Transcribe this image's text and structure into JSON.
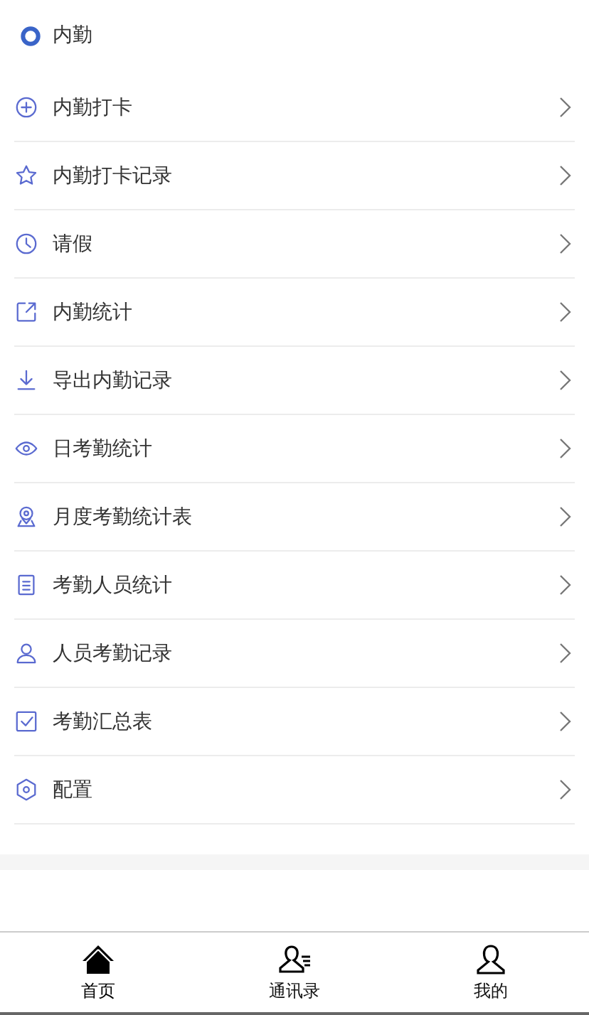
{
  "header": {
    "title": "内勤"
  },
  "menu": [
    {
      "kind": "plus",
      "label": "内勤打卡"
    },
    {
      "kind": "star",
      "label": "内勤打卡记录"
    },
    {
      "kind": "clock",
      "label": "请假"
    },
    {
      "kind": "share",
      "label": "内勤统计"
    },
    {
      "kind": "download",
      "label": "导出内勤记录"
    },
    {
      "kind": "eye",
      "label": "日考勤统计"
    },
    {
      "kind": "pin",
      "label": "月度考勤统计表"
    },
    {
      "kind": "doc",
      "label": "考勤人员统计"
    },
    {
      "kind": "person",
      "label": "人员考勤记录"
    },
    {
      "kind": "check",
      "label": "考勤汇总表"
    },
    {
      "kind": "gear",
      "label": "配置"
    }
  ],
  "tabbar": [
    {
      "kind": "home",
      "label": "首页",
      "selected": true
    },
    {
      "kind": "contacts",
      "label": "通讯录",
      "selected": false
    },
    {
      "kind": "me",
      "label": "我的",
      "selected": false
    }
  ]
}
